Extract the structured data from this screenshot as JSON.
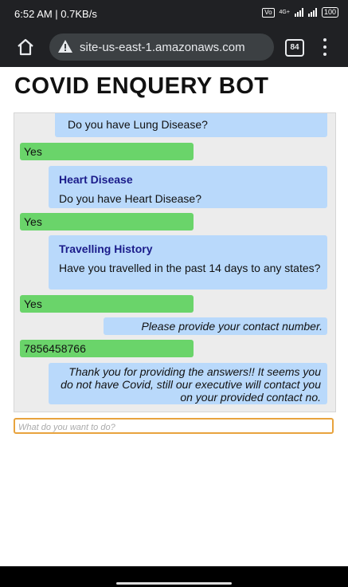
{
  "status_bar": {
    "time_speed": "6:52 AM | 0.7KB/s",
    "network": "4G+",
    "battery": "100"
  },
  "browser": {
    "url": "site-us-east-1.amazonaws.com",
    "tab_count": "84"
  },
  "page": {
    "title": "COVID ENQUERY BOT"
  },
  "chat": {
    "messages": [
      {
        "sender": "bot",
        "text": "Do you have Lung Disease?"
      },
      {
        "sender": "user",
        "text": "Yes"
      },
      {
        "sender": "bot",
        "title": "Heart Disease",
        "text": "Do you have Heart Disease?"
      },
      {
        "sender": "user",
        "text": "Yes"
      },
      {
        "sender": "bot",
        "title": "Travelling History",
        "text": "Have you travelled in the past 14 days to any states?"
      },
      {
        "sender": "user",
        "text": "Yes"
      },
      {
        "sender": "bot",
        "text": "Please provide your contact number."
      },
      {
        "sender": "user",
        "text": "7856458766"
      },
      {
        "sender": "bot",
        "text": "Thank you for providing the answers!! It seems you do not have Covid, still our executive will contact you on your provided contact no."
      }
    ]
  },
  "input": {
    "placeholder": "What do you want to do?",
    "value": ""
  },
  "colors": {
    "bot_bubble": "#b9d9fb",
    "user_bubble": "#6ad46a",
    "input_border": "#e8a33d"
  }
}
